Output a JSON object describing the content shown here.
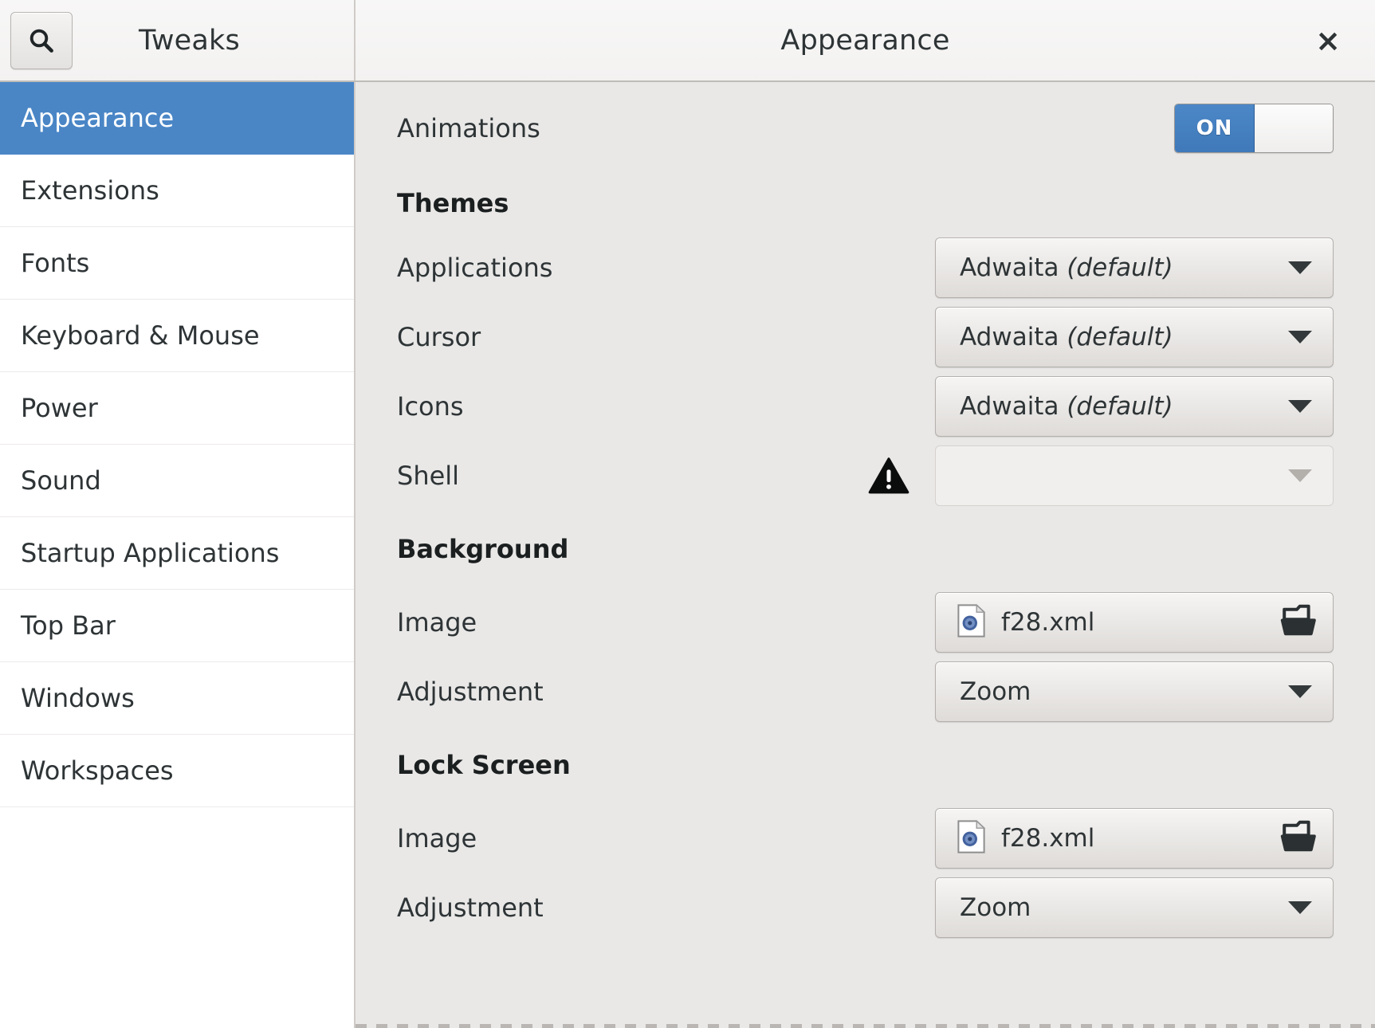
{
  "window": {
    "app_title": "Tweaks",
    "page_title": "Appearance",
    "close_label": "×",
    "search_icon": "search-icon",
    "accent_color": "#4a86c6",
    "header_bg": "#f6f5f4",
    "content_bg": "#e9e8e7"
  },
  "sidebar": {
    "items": [
      {
        "label": "Appearance",
        "selected": true
      },
      {
        "label": "Extensions",
        "selected": false
      },
      {
        "label": "Fonts",
        "selected": false
      },
      {
        "label": "Keyboard & Mouse",
        "selected": false
      },
      {
        "label": "Power",
        "selected": false
      },
      {
        "label": "Sound",
        "selected": false
      },
      {
        "label": "Startup Applications",
        "selected": false
      },
      {
        "label": "Top Bar",
        "selected": false
      },
      {
        "label": "Windows",
        "selected": false
      },
      {
        "label": "Workspaces",
        "selected": false
      }
    ]
  },
  "main": {
    "animations": {
      "label": "Animations",
      "switch_state": "ON",
      "switch_on": true
    },
    "themes": {
      "heading": "Themes",
      "applications": {
        "label": "Applications",
        "value": "Adwaita",
        "value_suffix": "(default)"
      },
      "cursor": {
        "label": "Cursor",
        "value": "Adwaita",
        "value_suffix": "(default)"
      },
      "icons": {
        "label": "Icons",
        "value": "Adwaita",
        "value_suffix": "(default)"
      },
      "shell": {
        "label": "Shell",
        "value": "",
        "value_suffix": "",
        "disabled": true,
        "warning_icon": "warning-triangle-icon"
      }
    },
    "background": {
      "heading": "Background",
      "image": {
        "label": "Image",
        "value": "f28.xml",
        "file_icon": "xml-file-icon",
        "open_icon": "folder-open-icon"
      },
      "adjustment": {
        "label": "Adjustment",
        "value": "Zoom"
      }
    },
    "lock_screen": {
      "heading": "Lock Screen",
      "image": {
        "label": "Image",
        "value": "f28.xml",
        "file_icon": "xml-file-icon",
        "open_icon": "folder-open-icon"
      },
      "adjustment": {
        "label": "Adjustment",
        "value": "Zoom"
      }
    }
  }
}
